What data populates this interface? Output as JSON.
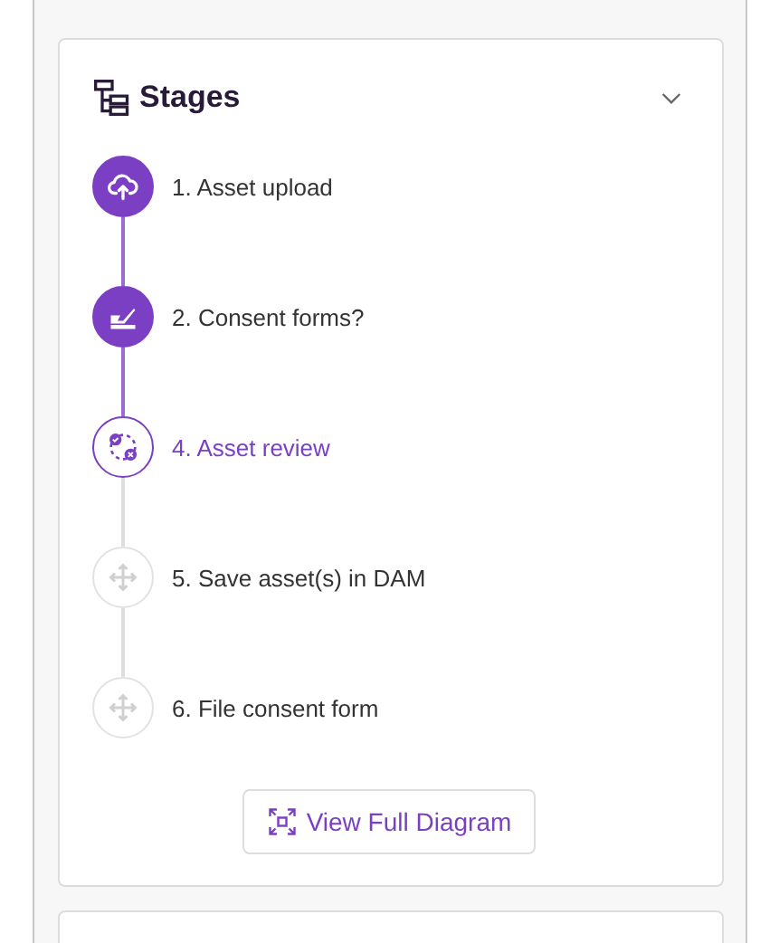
{
  "panel": {
    "title": "Stages",
    "expanded": true
  },
  "stages": [
    {
      "label": "1. Asset upload",
      "completed": true,
      "selected": false,
      "kind": "upload"
    },
    {
      "label": "2. Consent forms?",
      "completed": true,
      "selected": false,
      "kind": "sign"
    },
    {
      "label": "4. Asset review",
      "completed": false,
      "selected": true,
      "kind": "review"
    },
    {
      "label": "5. Save asset(s) in DAM",
      "completed": false,
      "selected": false,
      "kind": "move"
    },
    {
      "label": "6. File consent form",
      "completed": false,
      "selected": false,
      "kind": "move"
    }
  ],
  "button": {
    "label": "View Full Diagram"
  }
}
